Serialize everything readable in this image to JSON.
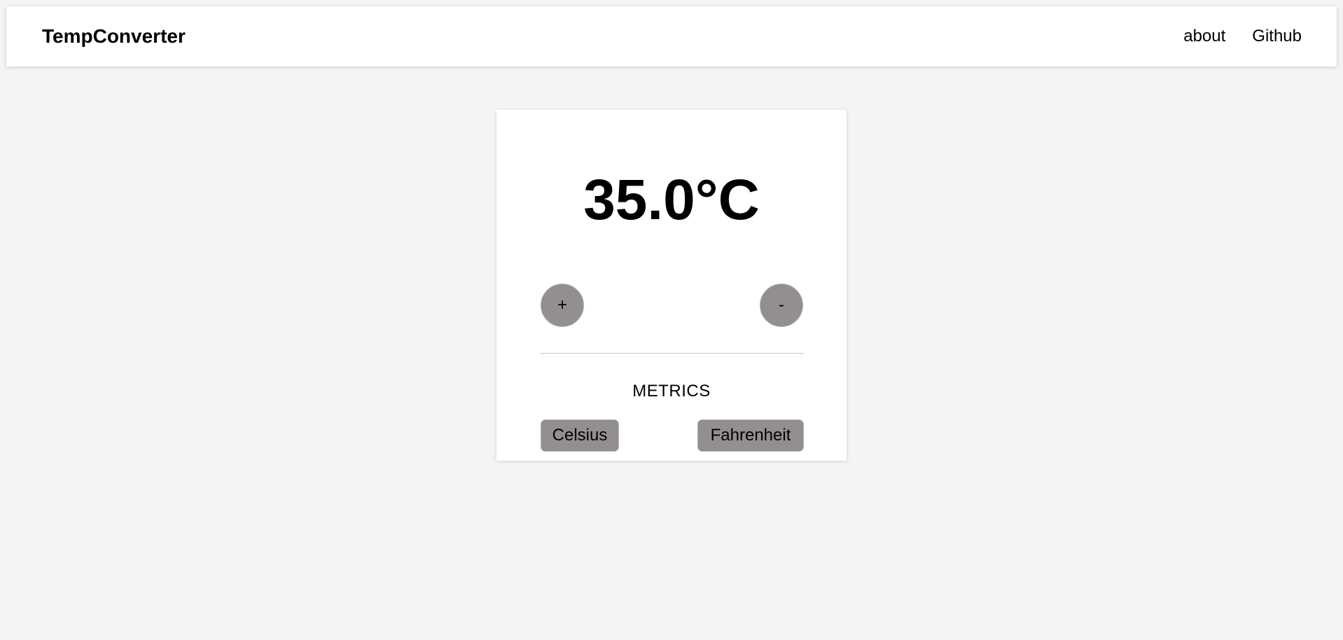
{
  "navbar": {
    "brand": "TempConverter",
    "links": [
      {
        "label": "about"
      },
      {
        "label": "Github"
      }
    ]
  },
  "converter": {
    "temperature_display": "35.0°C",
    "increment_label": "+",
    "decrement_label": "-",
    "metrics_heading": "METRICS",
    "units": [
      {
        "label": "Celsius"
      },
      {
        "label": "Fahrenheit"
      }
    ]
  },
  "colors": {
    "page_background": "#f4f4f4",
    "card_background": "#ffffff",
    "button_background": "#938f8f"
  }
}
